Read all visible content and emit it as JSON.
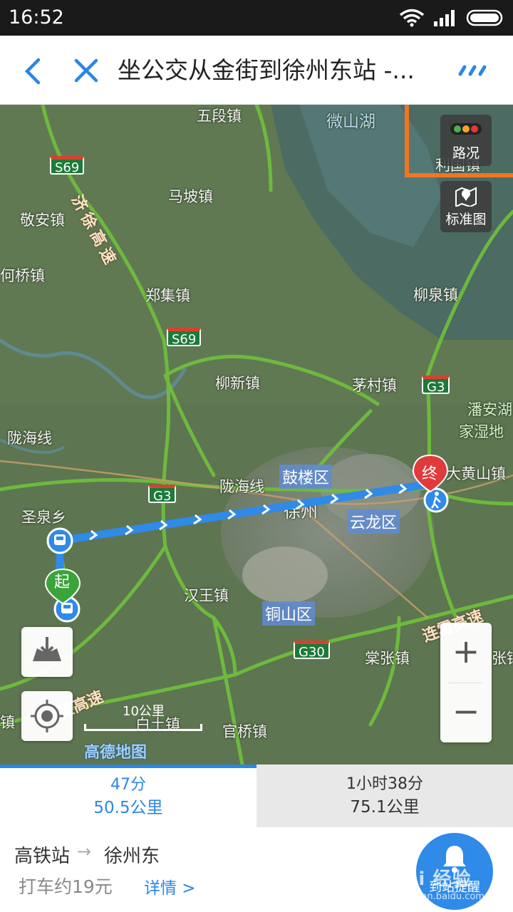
{
  "status_bar": {
    "time": "16:52"
  },
  "header": {
    "title": "坐公交从金街到徐州东站 -..."
  },
  "map": {
    "towns": [
      {
        "id": "wuduan",
        "name": "五段镇"
      },
      {
        "id": "mapo",
        "name": "马坡镇"
      },
      {
        "id": "jingan",
        "name": "敬安镇"
      },
      {
        "id": "heqiao",
        "name": "何桥镇"
      },
      {
        "id": "zhengji",
        "name": "郑集镇"
      },
      {
        "id": "liuxin",
        "name": "柳新镇"
      },
      {
        "id": "maocun",
        "name": "茅村镇"
      },
      {
        "id": "liuquan",
        "name": "柳泉镇"
      },
      {
        "id": "liguo",
        "name": "利国镇"
      },
      {
        "id": "shengquan",
        "name": "圣泉乡"
      },
      {
        "id": "hanwang",
        "name": "汉王镇"
      },
      {
        "id": "tangzhang",
        "name": "棠张镇"
      },
      {
        "id": "guanqiao",
        "name": "官桥镇"
      },
      {
        "id": "dahuangshan",
        "name": "大黄山镇"
      },
      {
        "id": "xuzhou",
        "name": "徐州"
      },
      {
        "id": "panan1",
        "name": "潘安湖"
      },
      {
        "id": "panan2",
        "name": "家湿地"
      },
      {
        "id": "zhangji",
        "name": "张镇"
      },
      {
        "id": "baishan",
        "name": "白土镇"
      },
      {
        "id": "longhai1",
        "name": "陇海线"
      },
      {
        "id": "longhai2",
        "name": "陇海线"
      },
      {
        "id": "lake",
        "name": "微山湖"
      },
      {
        "id": "ji",
        "name": "镇"
      }
    ],
    "districts": [
      {
        "id": "gulou",
        "name": "鼓楼区"
      },
      {
        "id": "yunlong",
        "name": "云龙区"
      },
      {
        "id": "tongshan",
        "name": "铜山区"
      }
    ],
    "highways": [
      {
        "id": "s69a",
        "code": "S69"
      },
      {
        "id": "s69b",
        "code": "S69"
      },
      {
        "id": "g3a",
        "code": "G3"
      },
      {
        "id": "g3b",
        "code": "G3"
      },
      {
        "id": "g30",
        "code": "G30"
      }
    ],
    "highway_names": [
      {
        "id": "jixu",
        "name": "济徐高速"
      },
      {
        "id": "lianhuo",
        "name": "连霍高速"
      },
      {
        "id": "huo",
        "name": "霍高速"
      }
    ],
    "start_marker": "起",
    "end_marker": "终",
    "traffic_button": "路况",
    "standard_map_button": "标准图",
    "scale_text": "10公里",
    "brand": "高德地图",
    "zoom_in": "+",
    "zoom_out": "−"
  },
  "routes": [
    {
      "time": "47分",
      "distance": "50.5公里",
      "selected": true
    },
    {
      "time": "1小时38分",
      "distance": "75.1公里",
      "selected": false
    }
  ],
  "info": {
    "from": "高铁站",
    "arrow": "→",
    "to": "徐州东",
    "taxi": "打车约19元",
    "detail": "详情 >",
    "remind": "到站提醒",
    "watermark": "Bai 经验",
    "watermark_sub": "jingyan.baidu.com"
  },
  "colors": {
    "accent": "#2b86e6",
    "route_line": "#2f8ae8",
    "highway": "#6ebe3b",
    "highlight": "#f07623",
    "start_pin": "#3aa43a",
    "end_pin": "#e03a3a"
  }
}
